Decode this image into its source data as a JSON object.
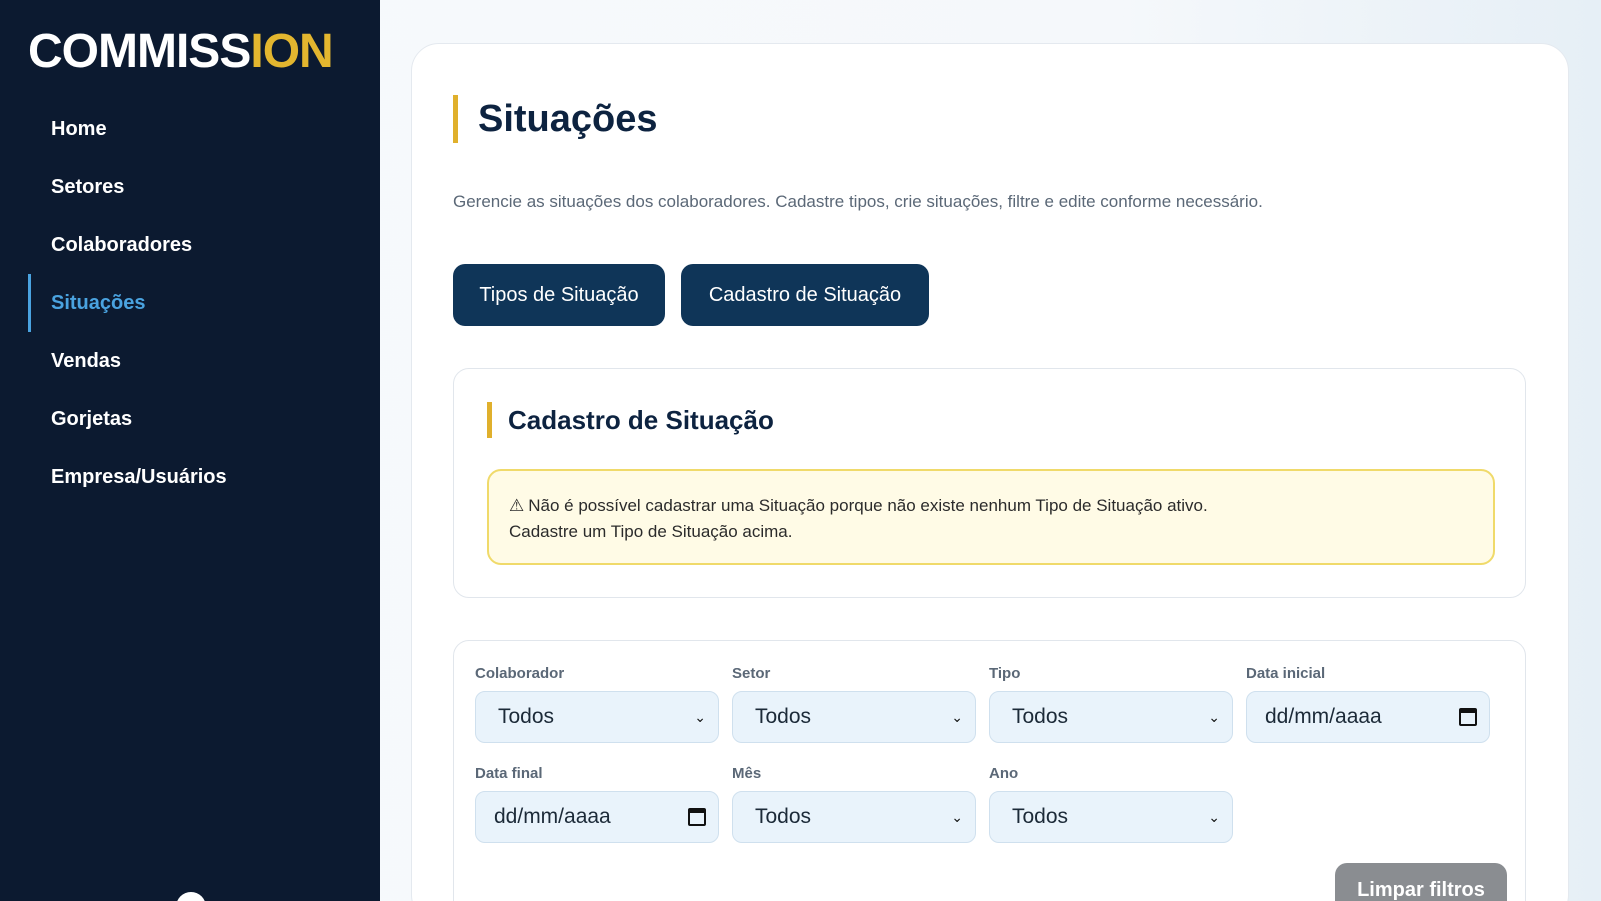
{
  "brand": {
    "logo_part1": "COMMISS",
    "logo_part2": "I",
    "logo_part3": "ON",
    "accent": "#e3b62f"
  },
  "sidebar": {
    "items": [
      {
        "label": "Home",
        "active": false
      },
      {
        "label": "Setores",
        "active": false
      },
      {
        "label": "Colaboradores",
        "active": false
      },
      {
        "label": "Situações",
        "active": true
      },
      {
        "label": "Vendas",
        "active": false
      },
      {
        "label": "Gorjetas",
        "active": false
      },
      {
        "label": "Empresa/Usuários",
        "active": false
      }
    ]
  },
  "page": {
    "title": "Situações",
    "subtitle": "Gerencie as situações dos colaboradores. Cadastre tipos, crie situações, filtre e edite conforme necessário."
  },
  "actions": {
    "tipos_label": "Tipos de Situação",
    "cadastro_label": "Cadastro de Situação"
  },
  "cadastro": {
    "title": "Cadastro de Situação",
    "alert_icon": "⚠",
    "alert_line1": "Não é possível cadastrar uma Situação porque não existe nenhum Tipo de Situação ativo.",
    "alert_line2": "Cadastre um Tipo de Situação acima."
  },
  "filters": {
    "colaborador": {
      "label": "Colaborador",
      "value": "Todos"
    },
    "setor": {
      "label": "Setor",
      "value": "Todos"
    },
    "tipo": {
      "label": "Tipo",
      "value": "Todos"
    },
    "data_inicial": {
      "label": "Data inicial",
      "placeholder": "dd/mm/aaaa"
    },
    "data_final": {
      "label": "Data final",
      "placeholder": "dd/mm/aaaa"
    },
    "mes": {
      "label": "Mês",
      "value": "Todos"
    },
    "ano": {
      "label": "Ano",
      "value": "Todos"
    },
    "clear_label": "Limpar filtros"
  },
  "colors": {
    "sidebar_bg": "#0c1a30",
    "active_nav": "#4aa3e0",
    "primary_button": "#0f3558",
    "gold_accent": "#e0b02c",
    "alert_bg": "#fffbe6",
    "alert_border": "#f0da6a"
  }
}
